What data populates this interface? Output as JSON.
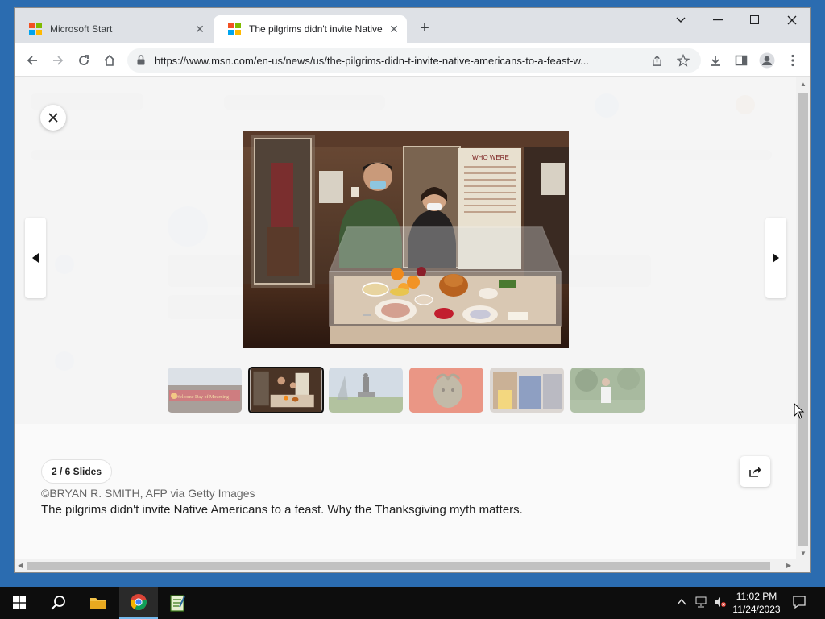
{
  "browser": {
    "tabs": [
      {
        "title": "Microsoft Start",
        "active": false
      },
      {
        "title": "The pilgrims didn't invite Native",
        "active": true
      }
    ],
    "url": "https://www.msn.com/en-us/news/us/the-pilgrims-didn-t-invite-native-americans-to-a-feast-w..."
  },
  "gallery": {
    "slides_label": "2 / 6 Slides",
    "credit": "©BRYAN R. SMITH, AFP via Getty Images",
    "caption": "The pilgrims didn't invite Native Americans to a feast. Why the Thanksgiving myth matters.",
    "current_index": 2,
    "total": 6,
    "photo_sign": "WHO WERE",
    "thumb_banner": "Welcome Day of Mourning"
  },
  "taskbar": {
    "time": "11:02 PM",
    "date": "11/24/2023"
  },
  "colors": {
    "tab_strip": "#dee1e6",
    "accent": "#76b9ed"
  }
}
